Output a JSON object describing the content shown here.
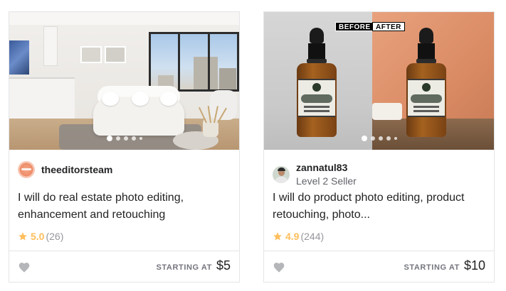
{
  "gigs": [
    {
      "seller_name": "theeditorsteam",
      "seller_level": "",
      "title": "I will do real estate photo editing, enhancement and retouching",
      "rating": "5.0",
      "reviews": "(26)",
      "price_label": "STARTING AT",
      "price": "$5",
      "carousel_dots": 5,
      "active_dot": 0
    },
    {
      "seller_name": "zannatul83",
      "seller_level": "Level 2 Seller",
      "title": "I will do product photo editing, product retouching, photo...",
      "rating": "4.9",
      "reviews": "(244)",
      "price_label": "STARTING AT",
      "price": "$10",
      "image_tags": {
        "before": "BEFORE",
        "after": "AFTER"
      },
      "carousel_dots": 5,
      "active_dot": 0
    }
  ],
  "icons": {
    "star": "star-icon",
    "heart": "heart-icon"
  },
  "colors": {
    "star": "#ffbe5b",
    "text": "#222325",
    "muted": "#95979d",
    "border": "#e4e5e7"
  }
}
